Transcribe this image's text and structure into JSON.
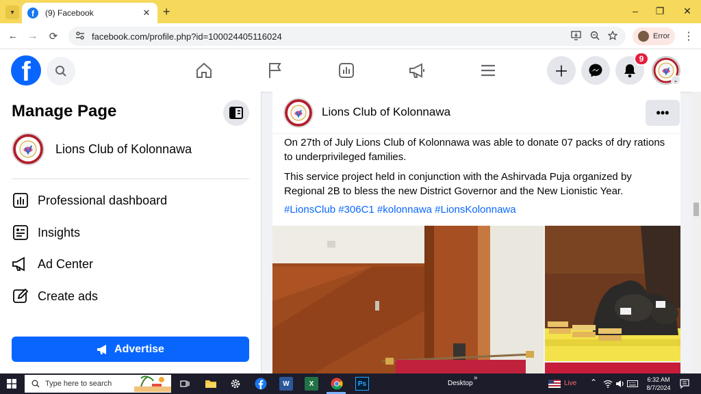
{
  "browser": {
    "tab_title": "(9) Facebook",
    "tab_close": "✕",
    "new_tab": "+",
    "url": "facebook.com/profile.php?id=100024405116024",
    "profile_label": "Error",
    "window_controls": {
      "minimize": "–",
      "maximize": "❐",
      "close": "✕"
    },
    "nav": {
      "back": "←",
      "forward": "→",
      "reload": "⟳"
    }
  },
  "header": {
    "logo": "f",
    "notification_count": "9",
    "caret": "⌄"
  },
  "sidebar": {
    "title": "Manage Page",
    "page_name": "Lions Club of Kolonnawa",
    "items": [
      {
        "label": "Professional dashboard",
        "icon": "dashboard-icon"
      },
      {
        "label": "Insights",
        "icon": "insights-icon"
      },
      {
        "label": "Ad Center",
        "icon": "megaphone-icon"
      },
      {
        "label": "Create ads",
        "icon": "pencil-icon"
      }
    ],
    "advertise_label": "Advertise"
  },
  "post": {
    "page_name": "Lions Club of Kolonnawa",
    "more": "•••",
    "paragraph1": "On 27th of July Lions Club of Kolonnawa was able to donate 07 packs of dry rations to underprivileged families.",
    "paragraph2": "This service project held in conjunction with the Ashirvada Puja organized by Regional 2B to bless the new District Governor and the New Lionistic Year.",
    "hashtags": "#LionsClub #306C1 #kolonnawa #LionsKolonnawa"
  },
  "taskbar": {
    "search_placeholder": "Type here to search",
    "desktop_label": "Desktop",
    "desktop_chevron": "»",
    "live_label": "Live",
    "time": "6:32 AM",
    "date": "8/7/2024",
    "apps": {
      "word": "W",
      "excel": "X",
      "photoshop": "Ps"
    }
  },
  "colors": {
    "facebook_blue": "#0866ff",
    "chrome_titlebar": "#f6d85a",
    "notification_red": "#e41e3f"
  }
}
